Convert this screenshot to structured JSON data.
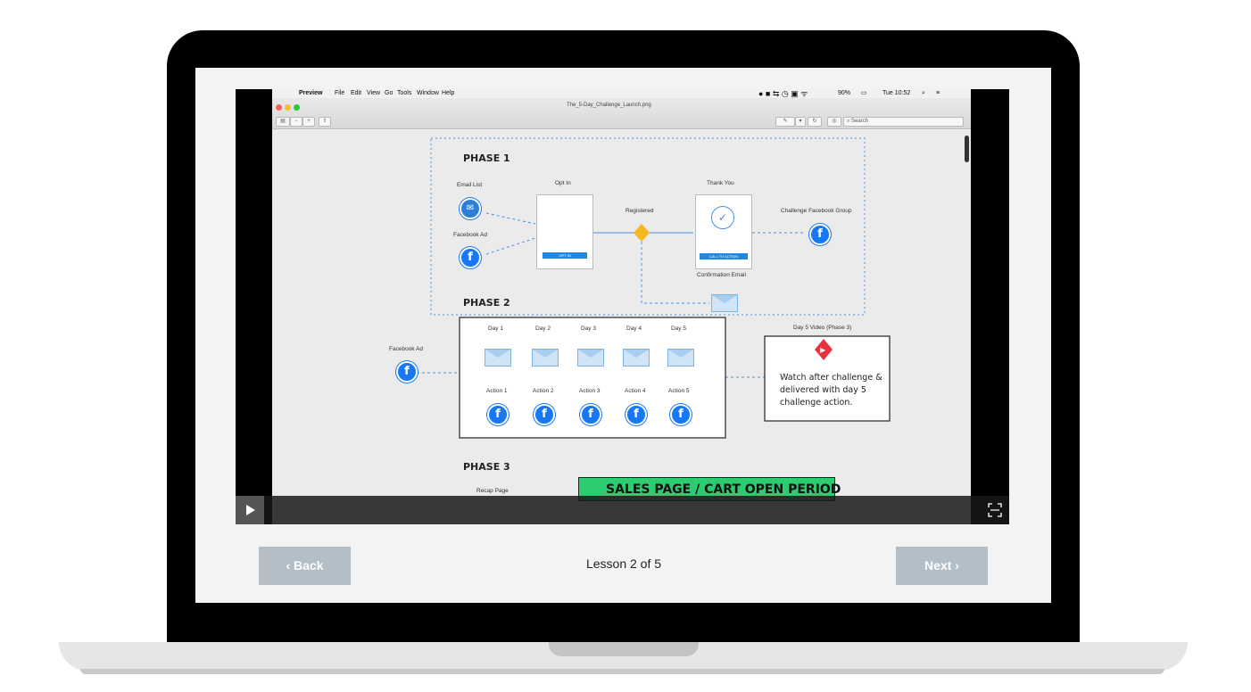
{
  "menubar": {
    "app": "Preview",
    "items": [
      "File",
      "Edit",
      "View",
      "Go",
      "Tools",
      "Window",
      "Help"
    ],
    "status": "90%",
    "clock": "Tue 10:52"
  },
  "window": {
    "title": "The_5-Day_Challenge_Launch.png",
    "search_placeholder": "Search"
  },
  "diagram": {
    "phase1": "PHASE 1",
    "phase2": "PHASE 2",
    "phase3": "PHASE 3",
    "email_list": "Email List",
    "facebook_ad": "Facebook Ad",
    "opt_in": "Opt In",
    "opt_in_button": "OPT IN",
    "registered": "Registered",
    "thank_you": "Thank You",
    "call_to_action": "CALL TO ACTION",
    "confirmation_email": "Confirmation Email",
    "challenge_group": "Challenge Facebook Group",
    "facebook_ad_2": "Facebook Ad",
    "days": [
      "Day 1",
      "Day 2",
      "Day 3",
      "Day 4",
      "Day 5"
    ],
    "actions": [
      "Action 1",
      "Action 2",
      "Action 3",
      "Action 4",
      "Action 5"
    ],
    "day5_video": "Day 5 Video (Phase 3)",
    "watch_text": "Watch after challenge & delivered with day 5 challenge action.",
    "recap_page": "Recap Page",
    "sales_page": "SALES PAGE / CART OPEN PERIOD"
  },
  "nav": {
    "back": "‹  Back",
    "lesson": "Lesson 2 of 5",
    "next": "Next  ›"
  },
  "colors": {
    "facebook": "#1877f2",
    "sales_green": "#2ecc71",
    "registered_diamond": "#f5b820",
    "video_diamond": "#e8333c",
    "nav_button": "#b3bec7"
  }
}
